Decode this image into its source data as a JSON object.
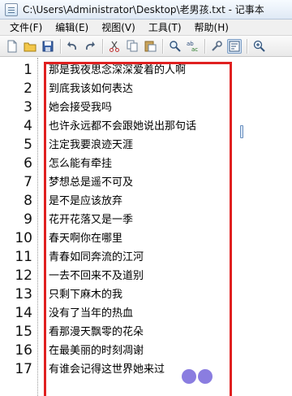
{
  "window": {
    "title": "C:\\Users\\Administrator\\Desktop\\老男孩.txt - 记事本"
  },
  "menu": [
    {
      "label": "文件(F)"
    },
    {
      "label": "编辑(E)"
    },
    {
      "label": "视图(V)"
    },
    {
      "label": "工具(T)"
    },
    {
      "label": "帮助(H)"
    }
  ],
  "toolbar": [
    {
      "icon": "new-file-icon"
    },
    {
      "icon": "open-folder-icon"
    },
    {
      "icon": "save-icon"
    },
    {
      "icon": "undo-icon"
    },
    {
      "icon": "redo-icon"
    },
    {
      "icon": "cut-icon"
    },
    {
      "icon": "copy-icon"
    },
    {
      "icon": "paste-icon"
    },
    {
      "icon": "find-icon"
    },
    {
      "icon": "replace-icon"
    },
    {
      "icon": "wrench-icon"
    },
    {
      "icon": "word-wrap-icon"
    },
    {
      "icon": "zoom-icon"
    }
  ],
  "editor": {
    "lines": [
      {
        "num": "1",
        "text": "那是我夜思念深深爱着的人啊"
      },
      {
        "num": "2",
        "text": "到底我该如何表达"
      },
      {
        "num": "3",
        "text": "她会接受我吗"
      },
      {
        "num": "4",
        "text": "也许永远都不会跟她说出那句话"
      },
      {
        "num": "5",
        "text": "注定我要浪迹天涯"
      },
      {
        "num": "6",
        "text": "怎么能有牵挂"
      },
      {
        "num": "7",
        "text": "梦想总是遥不可及"
      },
      {
        "num": "8",
        "text": "是不是应该放弃"
      },
      {
        "num": "9",
        "text": "花开花落又是一季"
      },
      {
        "num": "10",
        "text": "春天啊你在哪里"
      },
      {
        "num": "11",
        "text": "青春如同奔流的江河"
      },
      {
        "num": "12",
        "text": "一去不回来不及道别"
      },
      {
        "num": "13",
        "text": "只剩下麻木的我"
      },
      {
        "num": "14",
        "text": "没有了当年的热血"
      },
      {
        "num": "15",
        "text": "看那漫天飘零的花朵"
      },
      {
        "num": "16",
        "text": "在最美丽的时刻凋谢"
      },
      {
        "num": "17",
        "text": "有谁会记得这世界她来过"
      }
    ]
  },
  "colors": {
    "highlight_frame": "#e02020",
    "accent": "#8a7de0"
  }
}
